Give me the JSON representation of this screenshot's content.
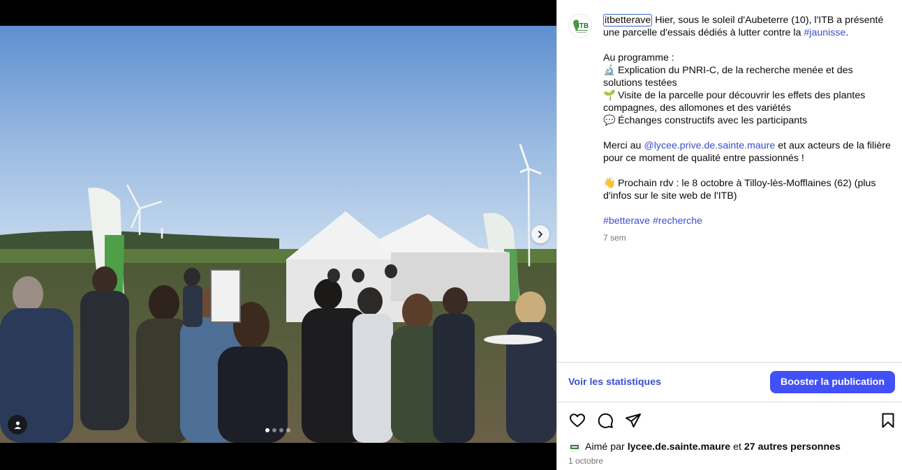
{
  "post": {
    "username": "itbetterave",
    "caption_intro": " Hier, sous le soleil d'Aubeterre (10), l'ITB a présenté",
    "caption_line2": "une parcelle d'essais dédiés à lutter contre la ",
    "hashtag_jaunisse": "#jaunisse",
    "period": ".",
    "programme_title": "Au programme :",
    "bullet1_emoji": "🔬",
    "bullet1_line1": " Explication du PNRI-C, de la recherche menée et des",
    "bullet1_line2": "solutions testées",
    "bullet2_emoji": "🌱",
    "bullet2_line1": " Visite de la parcelle pour découvrir les effets des plantes",
    "bullet2_line2": "compagnes, des allomones et des variétés",
    "bullet3_emoji": "💬",
    "bullet3_line1": " Échanges constructifs avec les participants",
    "merci_prefix": "Merci au ",
    "mention_lycee": "@lycee.prive.de.sainte.maure",
    "merci_suffix": " et aux acteurs de la filière",
    "merci_line2": "pour ce moment de qualité entre passionnés !",
    "rdv_emoji": "👋",
    "rdv_line1": " Prochain rdv : le 8 octobre à Tilloy-lès-Mofflaines (62) (plus",
    "rdv_line2": "d'infos sur le site web de l'ITB)",
    "hashtag_betterave": "#betterave",
    "hashtag_recherche": "#recherche",
    "time_ago": "7 sem"
  },
  "stats": {
    "link_label": "Voir les statistiques",
    "boost_label": "Booster la publication"
  },
  "likes": {
    "prefix": "Aimé par ",
    "user": "lycee.de.sainte.maure",
    "connector": " et ",
    "others": "27 autres personnes"
  },
  "date": "1 octobre",
  "carousel": {
    "slide_count": 4,
    "active_index": 0
  },
  "icons": {
    "like": "heart-icon",
    "comment": "comment-icon",
    "share": "share-icon",
    "save": "bookmark-icon",
    "next": "chevron-right-icon",
    "tag": "user-tag-icon"
  },
  "colors": {
    "link": "#3a4ed1",
    "boost_button": "#4150f7",
    "muted_text": "#737373",
    "border": "#dbdbdb"
  }
}
